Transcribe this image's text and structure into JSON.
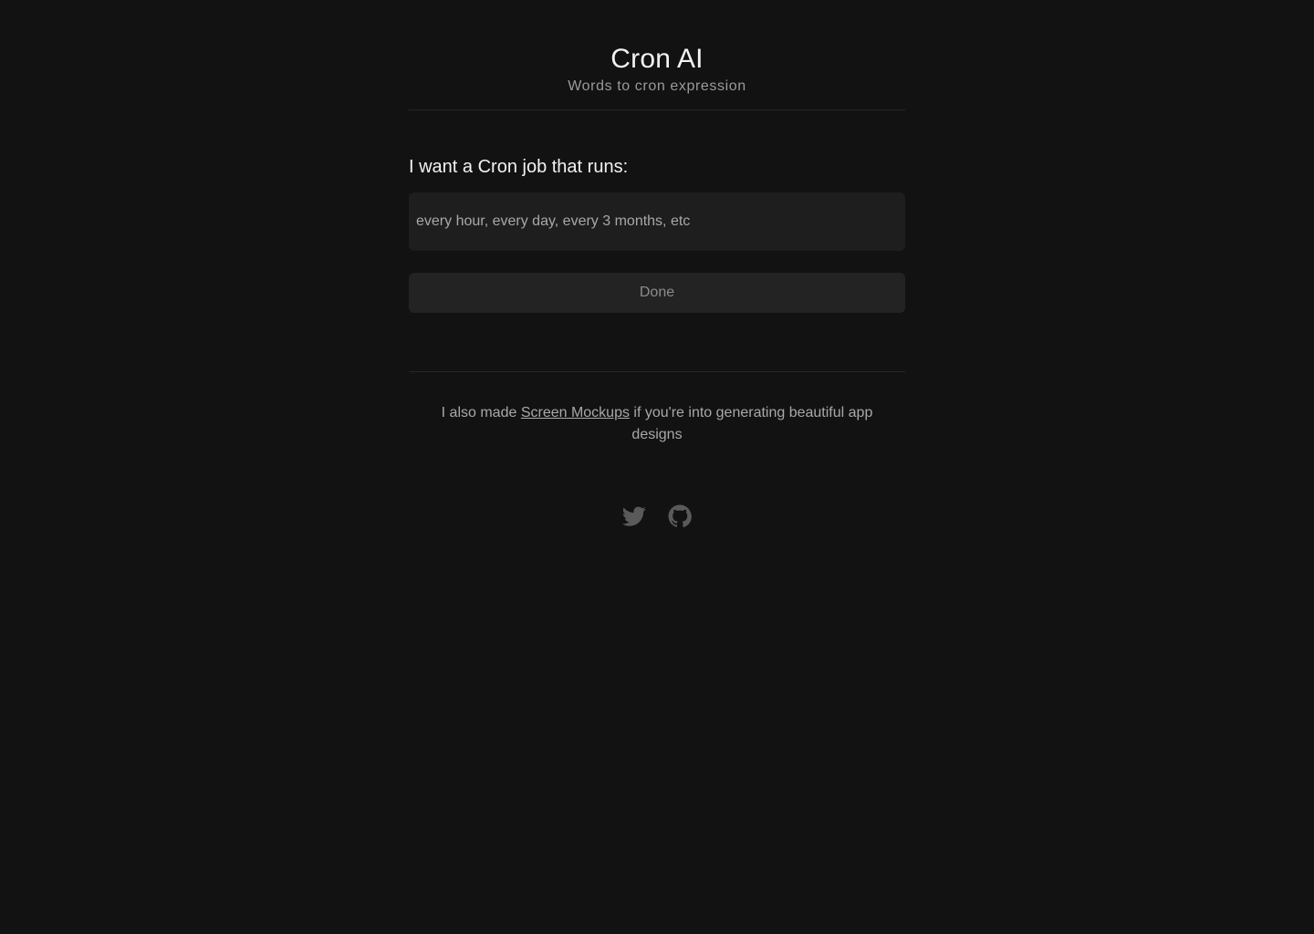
{
  "header": {
    "title": "Cron AI",
    "subtitle": "Words to cron expression"
  },
  "form": {
    "label": "I want a Cron job that runs:",
    "input_value": "",
    "input_placeholder": "every hour, every day, every 3 months, etc",
    "submit_label": "Done"
  },
  "promo": {
    "prefix": "I also made ",
    "link_text": "Screen Mockups",
    "suffix": " if you're into generating beautiful app designs"
  },
  "socials": {
    "items": [
      {
        "icon": "twitter-icon"
      },
      {
        "icon": "github-icon"
      }
    ]
  },
  "colors": {
    "background": "#121212",
    "text_primary": "#f2f2f2",
    "text_muted": "#a8a8a8",
    "surface": "#1e1e1e",
    "icon": "#5a5a5a"
  }
}
